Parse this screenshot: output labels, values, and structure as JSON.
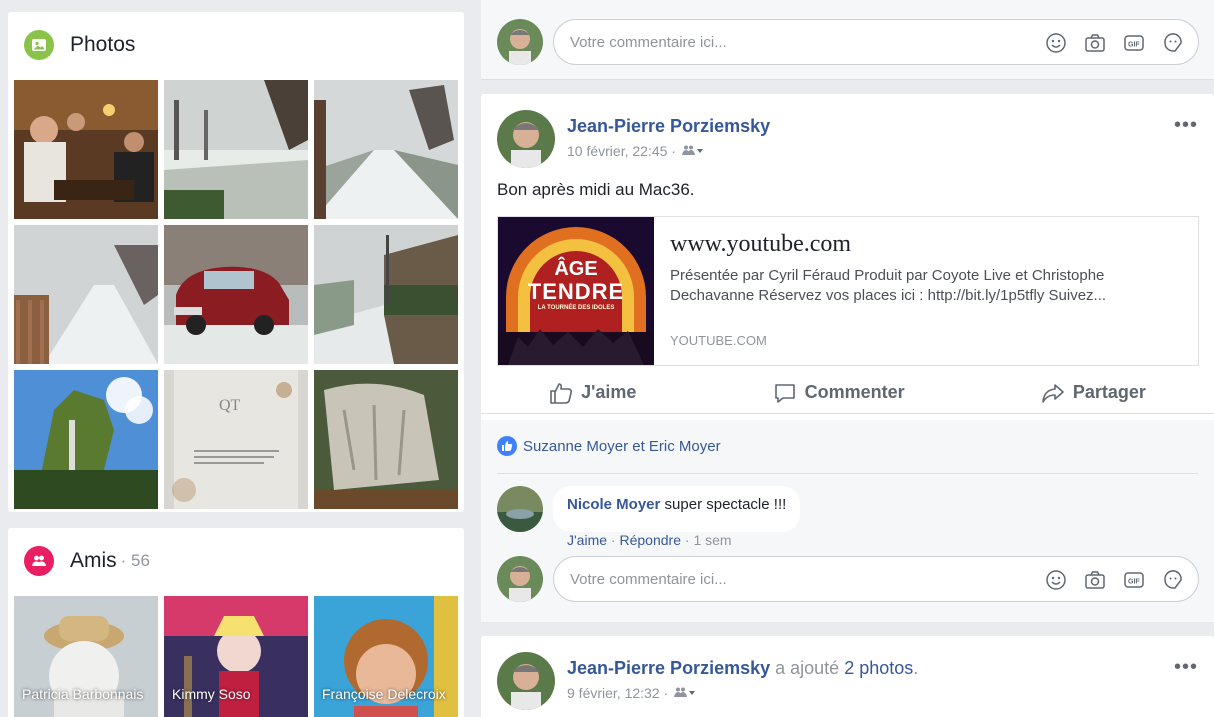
{
  "photos": {
    "title": "Photos",
    "icon": "photos-icon",
    "accent": "#8bc34a"
  },
  "friends": {
    "title": "Amis",
    "count": "· 56",
    "icon": "friends-icon",
    "accent": "#e91e63",
    "items": [
      {
        "name": "Patricia Barbonnais"
      },
      {
        "name": "Kimmy Soso"
      },
      {
        "name": "Françoise Delecroix"
      }
    ]
  },
  "top_comment": {
    "placeholder": "Votre commentaire ici..."
  },
  "post1": {
    "author": "Jean-Pierre Porziemsky",
    "time": "10 février, 22:45 ·",
    "text": "Bon après midi au Mac36.",
    "more": "•••",
    "link": {
      "title": "www.youtube.com",
      "description": "Présentée par Cyril Féraud Produit par Coyote Live et Christophe Dechavanne Réservez vos places ici : http://bit.ly/1p5tfly Suivez...",
      "source": "YOUTUBE.COM",
      "thumb_line1": "ÂGE",
      "thumb_line2": "TENDRE",
      "thumb_line3": "LA TOURNÉE DES IDOLES"
    },
    "actions": {
      "like": "J'aime",
      "comment": "Commenter",
      "share": "Partager"
    },
    "likes_text": "Suzanne Moyer et Eric Moyer",
    "comment": {
      "author": "Nicole Moyer",
      "text": "super spectacle !!!",
      "like": "J'aime",
      "reply": "Répondre",
      "time": "1 sem"
    },
    "comment_placeholder": "Votre commentaire ici..."
  },
  "post2": {
    "author": "Jean-Pierre Porziemsky",
    "added": "a ajouté",
    "added_link": "2 photos",
    "period": ".",
    "time": "9 février, 12:32 ·",
    "more": "•••"
  }
}
